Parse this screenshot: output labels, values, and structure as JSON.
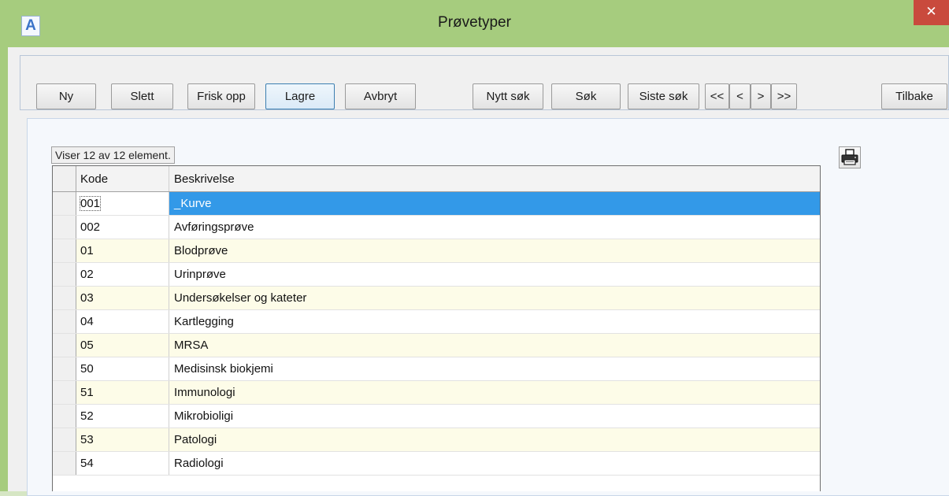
{
  "window": {
    "title": "Prøvetyper",
    "app_icon_letter": "A",
    "close_glyph": "✕",
    "accent_color": "#a6cc7e"
  },
  "toolbar": {
    "ny": "Ny",
    "slett": "Slett",
    "frisk_opp": "Frisk opp",
    "lagre": "Lagre",
    "avbryt": "Avbryt",
    "nytt_sok": "Nytt søk",
    "sok": "Søk",
    "siste_sok": "Siste søk",
    "first": "<<",
    "prev": "<",
    "next": ">",
    "last": ">>",
    "tilbake": "Tilbake"
  },
  "grid": {
    "status": "Viser 12 av 12 element.",
    "columns": {
      "kode": "Kode",
      "beskrivelse": "Beskrivelse"
    },
    "selected_color": "#3399e8",
    "rows": [
      {
        "kode": "001",
        "beskrivelse": "_Kurve",
        "selected": true
      },
      {
        "kode": "002",
        "beskrivelse": "Avføringsprøve"
      },
      {
        "kode": "01",
        "beskrivelse": "Blodprøve"
      },
      {
        "kode": "02",
        "beskrivelse": "Urinprøve"
      },
      {
        "kode": "03",
        "beskrivelse": "Undersøkelser og kateter"
      },
      {
        "kode": "04",
        "beskrivelse": "Kartlegging"
      },
      {
        "kode": "05",
        "beskrivelse": "MRSA"
      },
      {
        "kode": "50",
        "beskrivelse": "Medisinsk biokjemi"
      },
      {
        "kode": "51",
        "beskrivelse": "Immunologi"
      },
      {
        "kode": "52",
        "beskrivelse": "Mikrobioligi"
      },
      {
        "kode": "53",
        "beskrivelse": "Patologi"
      },
      {
        "kode": "54",
        "beskrivelse": "Radiologi"
      }
    ]
  },
  "icons": {
    "print": "printer-icon",
    "app": "app-logo-icon",
    "close": "close-icon"
  }
}
